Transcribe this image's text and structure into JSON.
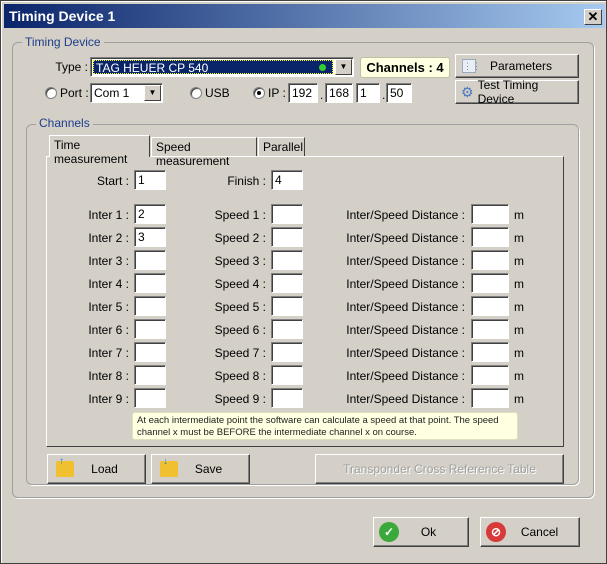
{
  "window": {
    "title": "Timing Device 1",
    "close": "✕"
  },
  "device": {
    "group_label": "Timing Device",
    "type_label": "Type :",
    "type_value": "TAG HEUER CP 540",
    "status_led_color": "#33cc33",
    "channels": "Channels : 4",
    "parameters_label": "Parameters",
    "test_label": "Test Timing Device",
    "port_label": "Port :",
    "port_value": "Com 1",
    "usb_label": "USB",
    "ip_label": "IP :",
    "ip": [
      "192",
      "168",
      "1",
      "50"
    ],
    "selected_connection": "IP"
  },
  "channels": {
    "group_label": "Channels",
    "tabs": [
      {
        "label": "Time measurement",
        "active": true
      },
      {
        "label": "Speed measurement"
      },
      {
        "label": "Parallel"
      }
    ],
    "start_label": "Start :",
    "start_value": "1",
    "finish_label": "Finish :",
    "finish_value": "4",
    "rows": [
      {
        "inter_label": "Inter 1 :",
        "inter": "2",
        "speed_label": "Speed 1 :",
        "speed": "",
        "dist_label": "Inter/Speed Distance :",
        "dist": "",
        "unit": "m"
      },
      {
        "inter_label": "Inter 2 :",
        "inter": "3",
        "speed_label": "Speed 2 :",
        "speed": "",
        "dist_label": "Inter/Speed Distance :",
        "dist": "",
        "unit": "m"
      },
      {
        "inter_label": "Inter 3 :",
        "inter": "",
        "speed_label": "Speed 3 :",
        "speed": "",
        "dist_label": "Inter/Speed Distance :",
        "dist": "",
        "unit": "m"
      },
      {
        "inter_label": "Inter 4 :",
        "inter": "",
        "speed_label": "Speed 4 :",
        "speed": "",
        "dist_label": "Inter/Speed Distance :",
        "dist": "",
        "unit": "m"
      },
      {
        "inter_label": "Inter 5 :",
        "inter": "",
        "speed_label": "Speed 5 :",
        "speed": "",
        "dist_label": "Inter/Speed Distance :",
        "dist": "",
        "unit": "m"
      },
      {
        "inter_label": "Inter 6 :",
        "inter": "",
        "speed_label": "Speed 6 :",
        "speed": "",
        "dist_label": "Inter/Speed Distance :",
        "dist": "",
        "unit": "m"
      },
      {
        "inter_label": "Inter 7 :",
        "inter": "",
        "speed_label": "Speed 7 :",
        "speed": "",
        "dist_label": "Inter/Speed Distance :",
        "dist": "",
        "unit": "m"
      },
      {
        "inter_label": "Inter 8 :",
        "inter": "",
        "speed_label": "Speed 8 :",
        "speed": "",
        "dist_label": "Inter/Speed Distance :",
        "dist": "",
        "unit": "m"
      },
      {
        "inter_label": "Inter 9 :",
        "inter": "",
        "speed_label": "Speed 9 :",
        "speed": "",
        "dist_label": "Inter/Speed Distance :",
        "dist": "",
        "unit": "m"
      }
    ],
    "hint": "At each intermediate point the software can calculate a speed at that point. The speed channel x must be BEFORE the intermediate channel x on course.",
    "load_label": "Load",
    "save_label": "Save",
    "transponder_label": "Transponder Cross Reference Table"
  },
  "footer": {
    "ok_label": "Ok",
    "cancel_label": "Cancel"
  }
}
